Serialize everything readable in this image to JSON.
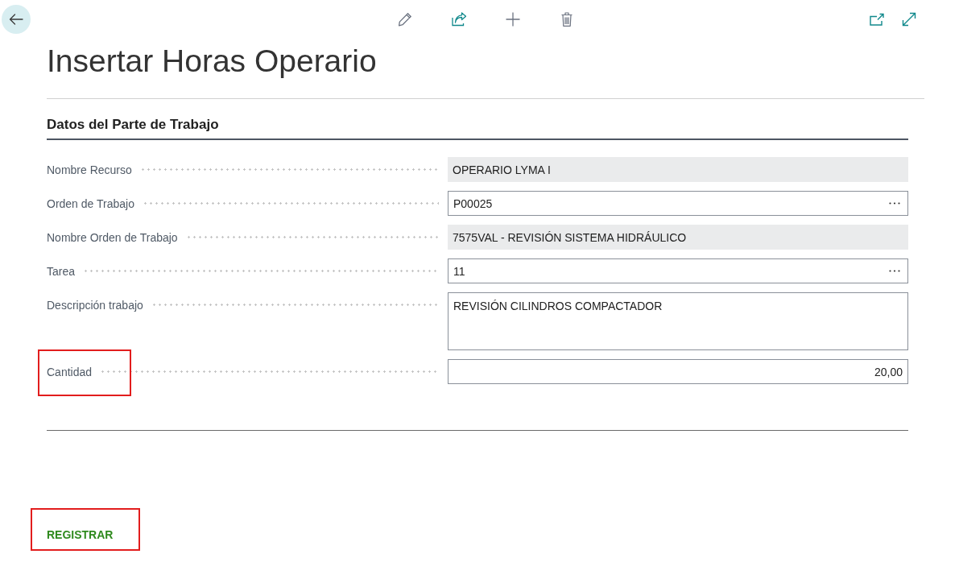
{
  "page": {
    "title": "Insertar Horas Operario"
  },
  "section": {
    "title": "Datos del Parte de Trabajo",
    "fields": [
      {
        "label": "Nombre Recurso",
        "value": "OPERARIO LYMA I",
        "kind": "readonly",
        "highlighted": false
      },
      {
        "label": "Orden de Trabajo",
        "value": "P00025",
        "kind": "lookup",
        "highlighted": false
      },
      {
        "label": "Nombre Orden de Trabajo",
        "value": "7575VAL - REVISIÓN SISTEMA HIDRÁULICO",
        "kind": "readonly",
        "highlighted": false
      },
      {
        "label": "Tarea",
        "value": "11",
        "kind": "lookup",
        "highlighted": false
      },
      {
        "label": "Descripción trabajo",
        "value": "REVISIÓN CILINDROS COMPACTADOR",
        "kind": "multiline",
        "highlighted": false
      },
      {
        "label": "Cantidad",
        "value": "20,00",
        "kind": "number",
        "highlighted": true
      }
    ]
  },
  "actions": [
    {
      "label": "REGISTRAR",
      "highlighted": true
    }
  ]
}
